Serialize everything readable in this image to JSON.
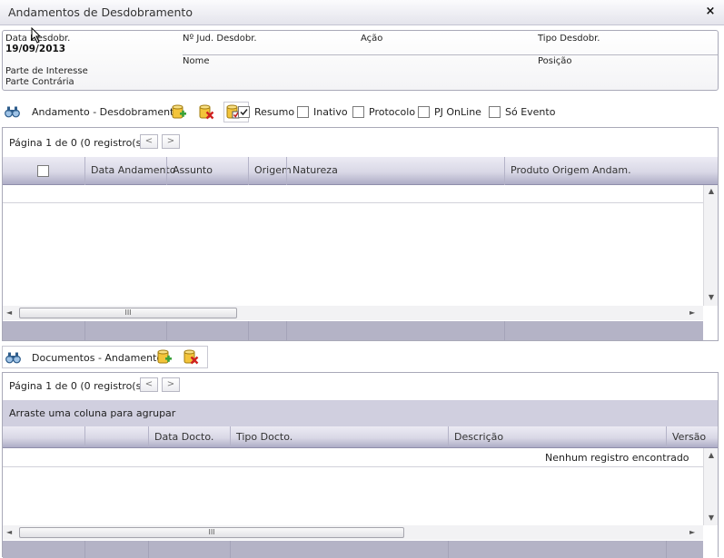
{
  "window": {
    "title": "Andamentos de Desdobramento",
    "close_label": "×"
  },
  "info": {
    "data_desdobr_label": "Data Desdobr.",
    "data_desdobr_value": "19/09/2013",
    "jud_desdobr_label": "Nº Jud. Desdobr.",
    "acao_label": "Ação",
    "tipo_desdobr_label": "Tipo Desdobr.",
    "nome_label": "Nome",
    "posicao_label": "Posição",
    "parte_interesse_label": "Parte de Interesse",
    "parte_contraria_label": "Parte Contrária"
  },
  "andamento_toolbar": {
    "label": "Andamento - Desdobramento",
    "checkboxes": [
      {
        "label": "Resumo",
        "checked": true
      },
      {
        "label": "Inativo",
        "checked": false
      },
      {
        "label": "Protocolo",
        "checked": false
      },
      {
        "label": "PJ OnLine",
        "checked": false
      },
      {
        "label": "Só Evento",
        "checked": false
      }
    ]
  },
  "andamento_grid": {
    "pager": "Página 1 de 0 (0 registro(s))",
    "prev": "<",
    "next": ">",
    "columns": [
      "Data Andamento",
      "Assunto",
      "Origem",
      "Natureza",
      "Produto Origem Andam."
    ],
    "select_all_checked": false,
    "hscroll_thumb": "III"
  },
  "documentos_toolbar": {
    "label": "Documentos - Andamento"
  },
  "documentos_grid": {
    "pager": "Página 1 de 0 (0 registro(s))",
    "prev": "<",
    "next": ">",
    "group_hint": "Arraste uma coluna para agrupar",
    "columns": [
      "Data Docto.",
      "Tipo Docto.",
      "Descrição",
      "Versão"
    ],
    "empty_message": "Nenhum registro encontrado",
    "hscroll_thumb": "III"
  },
  "icons": {
    "search": "binoculars-icon",
    "add": "database-add-icon",
    "remove": "database-remove-icon",
    "check": "database-check-icon"
  },
  "colors": {
    "header_gradient_bottom": "#aeadc6",
    "footer_bar": "#b4b3c6",
    "group_bar": "#d0cfdf",
    "add_green": "#3aa23a",
    "remove_red": "#d02020"
  }
}
